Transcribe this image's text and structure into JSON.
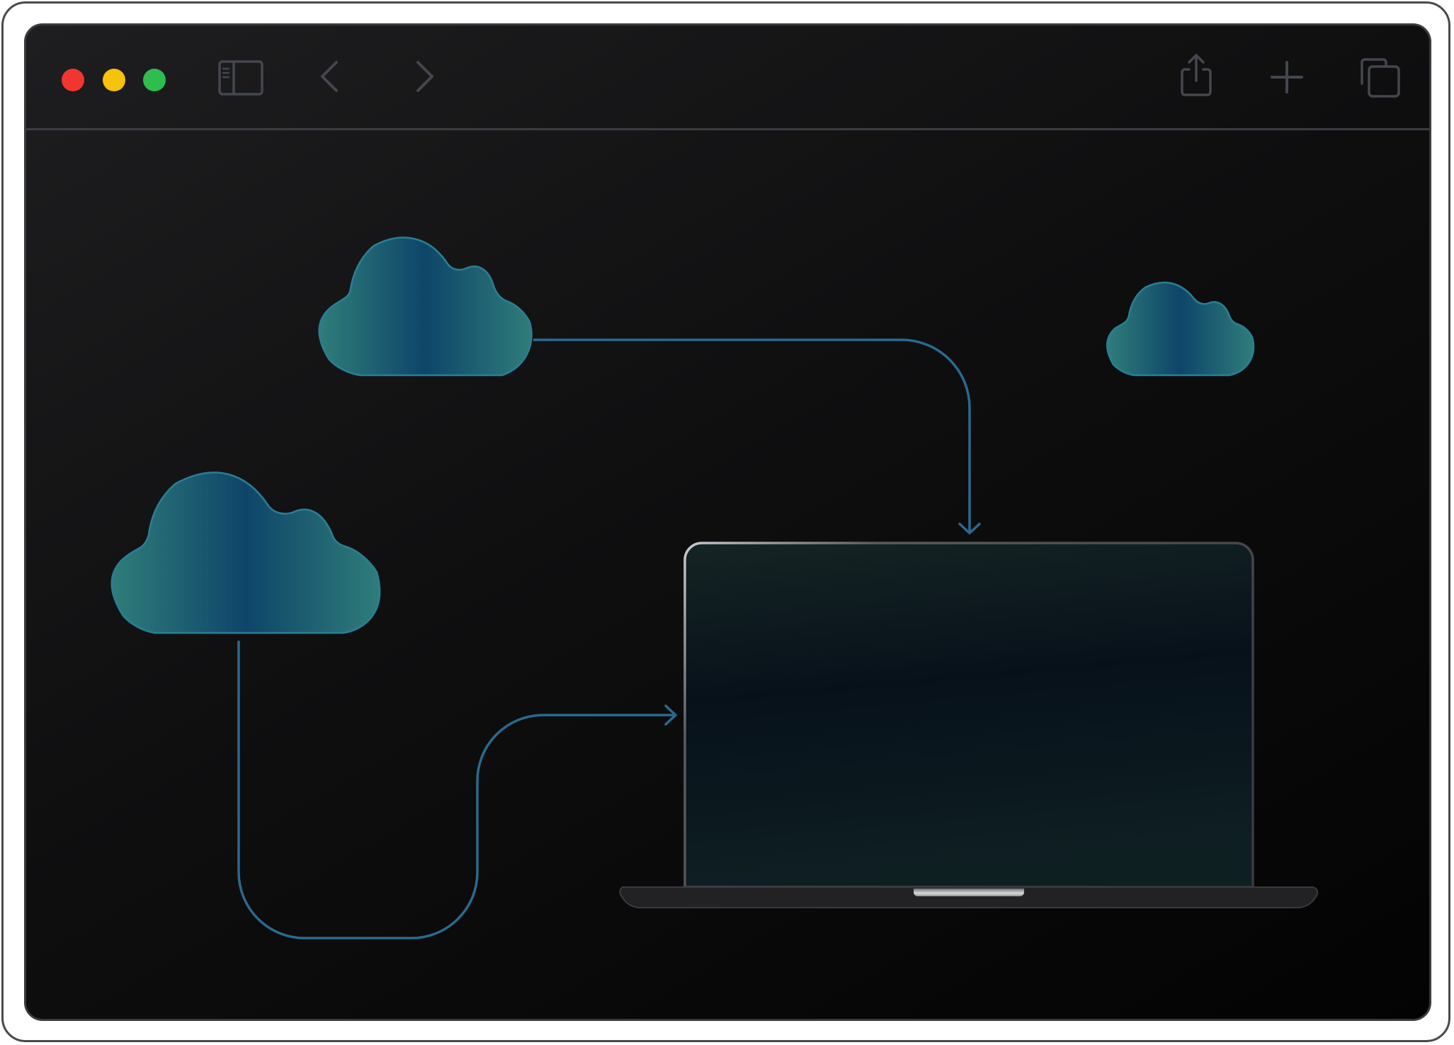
{
  "window": {
    "traffic_lights": {
      "close_color": "#f0362f",
      "minimize_color": "#f5c20c",
      "zoom_color": "#2fbd4f"
    },
    "toolbar": {
      "icons": [
        "sidebar-icon",
        "back-icon",
        "forward-icon",
        "share-icon",
        "new-tab-icon",
        "tab-overview-icon"
      ]
    }
  },
  "illustration": {
    "elements": [
      "cloud-large",
      "cloud-medium",
      "cloud-small",
      "laptop",
      "connector-arrow-top",
      "connector-arrow-bottom"
    ],
    "accent_color": "#2a6a8e",
    "cloud_gradient": [
      "#2a7676",
      "#0f4a6e",
      "#2a7676"
    ]
  }
}
